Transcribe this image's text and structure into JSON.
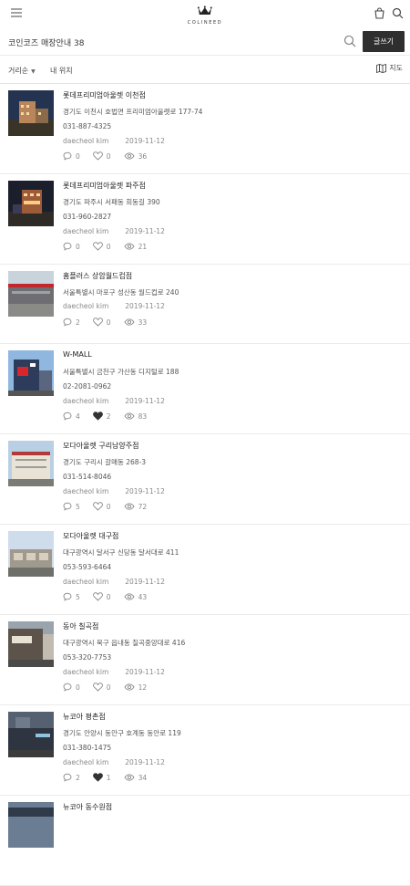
{
  "header": {
    "logo_text": "COLINEED"
  },
  "page": {
    "title": "코인코즈 매장안내 38",
    "write_button": "글쓰기"
  },
  "filters": {
    "sort_label": "거리순",
    "location_label": "내 위치",
    "map_label": "지도"
  },
  "stores": [
    {
      "name": "롯데프리미엄아울렛 이천점",
      "address": "경기도 이천시 호법면 프리미엄아울렛로 177-74",
      "phone": "031-887-4325",
      "author": "daecheol kim",
      "date": "2019-11-12",
      "comments": "0",
      "likes": "0",
      "liked": false,
      "views": "36"
    },
    {
      "name": "롯데프리미엄아울렛 파주점",
      "address": "경기도 파주시 서패동 회동길 390",
      "phone": "031-960-2827",
      "author": "daecheol kim",
      "date": "2019-11-12",
      "comments": "0",
      "likes": "0",
      "liked": false,
      "views": "21"
    },
    {
      "name": "홈플러스 상암월드컵점",
      "address": "서울특별시 마포구 성산동 월드컵로 240",
      "phone": "",
      "author": "daecheol kim",
      "date": "2019-11-12",
      "comments": "2",
      "likes": "0",
      "liked": false,
      "views": "33"
    },
    {
      "name": "W-MALL",
      "address": "서울특별시 금천구 가산동 디지털로 188",
      "phone": "02-2081-0962",
      "author": "daecheol kim",
      "date": "2019-11-12",
      "comments": "4",
      "likes": "2",
      "liked": true,
      "views": "83"
    },
    {
      "name": "모다아울렛 구리남양주점",
      "address": "경기도 구리시 갈매동 268-3",
      "phone": "031-514-8046",
      "author": "daecheol kim",
      "date": "2019-11-12",
      "comments": "5",
      "likes": "0",
      "liked": false,
      "views": "72"
    },
    {
      "name": "모다아울렛 대구점",
      "address": "대구광역시 달서구 신당동 달서대로 411",
      "phone": "053-593-6464",
      "author": "daecheol kim",
      "date": "2019-11-12",
      "comments": "5",
      "likes": "0",
      "liked": false,
      "views": "43"
    },
    {
      "name": "동아 칠곡점",
      "address": "대구광역시 북구 읍내동 칠곡중앙대로 416",
      "phone": "053-320-7753",
      "author": "daecheol kim",
      "date": "2019-11-12",
      "comments": "0",
      "likes": "0",
      "liked": false,
      "views": "12"
    },
    {
      "name": "뉴코아 평촌점",
      "address": "경기도 안양시 동안구 호계동 동안로 119",
      "phone": "031-380-1475",
      "author": "daecheol kim",
      "date": "2019-11-12",
      "comments": "2",
      "likes": "1",
      "liked": true,
      "views": "34"
    },
    {
      "name": "뉴코아 동수원점",
      "address": "",
      "phone": "",
      "author": "",
      "date": "",
      "comments": "",
      "likes": "",
      "liked": false,
      "views": ""
    }
  ]
}
